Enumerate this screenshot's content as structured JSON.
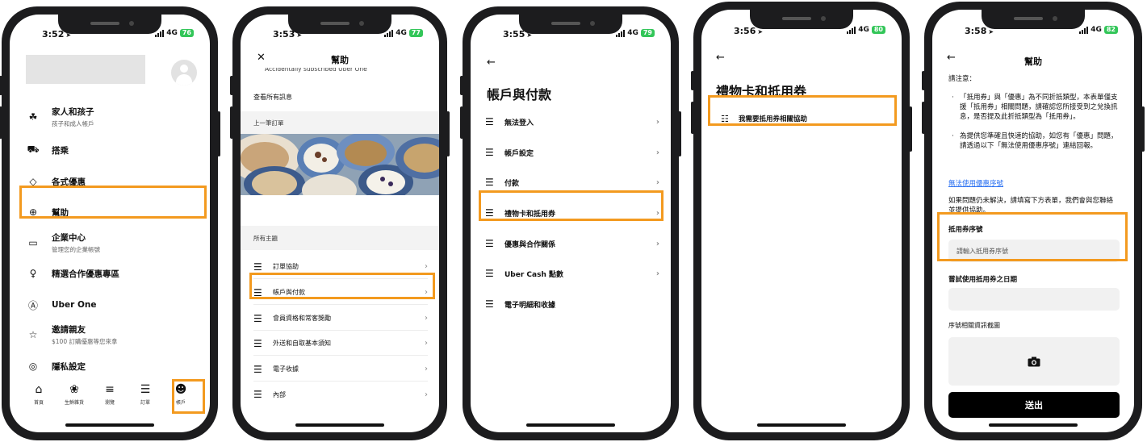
{
  "phones": [
    {
      "status": {
        "time": "3:52",
        "network": "4G",
        "battery": "76"
      },
      "items": [
        {
          "icon": "family-icon",
          "glyph": "☘",
          "label": "家人和孩子",
          "sub": "孩子和成人帳戶"
        },
        {
          "icon": "car-icon",
          "glyph": "⛟",
          "label": "搭乘",
          "sub": ""
        },
        {
          "icon": "tag-icon",
          "glyph": "◇",
          "label": "各式優惠",
          "sub": ""
        },
        {
          "icon": "help-icon",
          "glyph": "⊕",
          "label": "幫助",
          "sub": ""
        },
        {
          "icon": "briefcase-icon",
          "glyph": "▭",
          "label": "企業中心",
          "sub": "管理您的企業帳號"
        },
        {
          "icon": "trophy-icon",
          "glyph": "♀",
          "label": "精選合作優惠專區",
          "sub": ""
        },
        {
          "icon": "uber-one-icon",
          "glyph": "Ⓐ",
          "label": "Uber One",
          "sub": ""
        },
        {
          "icon": "invite-icon",
          "glyph": "☆",
          "label": "邀請親友",
          "sub": "$100 訂購優惠等您來拿"
        },
        {
          "icon": "privacy-icon",
          "glyph": "◎",
          "label": "隱私設定",
          "sub": ""
        }
      ],
      "tabs": [
        {
          "icon": "home-icon",
          "glyph": "⌂",
          "label": "首頁"
        },
        {
          "icon": "grocery-icon",
          "glyph": "❀",
          "label": "生鮮雜貨"
        },
        {
          "icon": "browse-icon",
          "glyph": "≡",
          "label": "瀏覽"
        },
        {
          "icon": "orders-icon",
          "glyph": "☰",
          "label": "訂單"
        },
        {
          "icon": "account-icon",
          "glyph": "☻",
          "label": "帳戶"
        }
      ]
    },
    {
      "status": {
        "time": "3:53",
        "network": "4G",
        "battery": "77"
      },
      "title": "幫助",
      "clipped_text": "Accidentally subscribed Uber One",
      "view_all": "查看所有訊息",
      "last_order": "上一筆訂單",
      "all_topics": "所有主題",
      "topics": [
        "訂單協助",
        "帳戶與付款",
        "會員資格和常客獎勵",
        "外送和自取基本須知",
        "電子收據",
        "內部"
      ]
    },
    {
      "status": {
        "time": "3:55",
        "network": "4G",
        "battery": "79"
      },
      "title": "帳戶與付款",
      "items": [
        "無法登入",
        "帳戶設定",
        "付款",
        "禮物卡和抵用券",
        "優惠與合作關係",
        "Uber Cash 點數",
        "電子明細和收據"
      ]
    },
    {
      "status": {
        "time": "3:56",
        "network": "4G",
        "battery": "80"
      },
      "title": "禮物卡和抵用券",
      "item": "我需要抵用券相關協助"
    },
    {
      "status": {
        "time": "3:58",
        "network": "4G",
        "battery": "82"
      },
      "title": "幫助",
      "note_title": "請注意：",
      "bullets": [
        "「抵用券」與「優惠」為不同折抵類型，本表單僅支援「抵用券」相關問題，請確認您所接受到之兌換訊息，是否提及此折抵類型為「抵用券」。",
        "為提供您準確且快速的協助，如您有「優惠」問題，請透過以下「無法使用優惠序號」連結回報。"
      ],
      "link": "無法使用優惠序號",
      "info": "如果問題仍未解決，請填寫下方表單，我們會與您聯絡並提供協助。",
      "field1_label": "抵用券序號",
      "field1_placeholder": "請輸入抵用券序號",
      "field2_label": "嘗試使用抵用券之日期",
      "field3_label": "序號相關資訊截圖",
      "submit": "送出"
    }
  ],
  "colors": {
    "highlight": "#f39a1f",
    "link": "#276ef1",
    "battery": "#33c659"
  }
}
